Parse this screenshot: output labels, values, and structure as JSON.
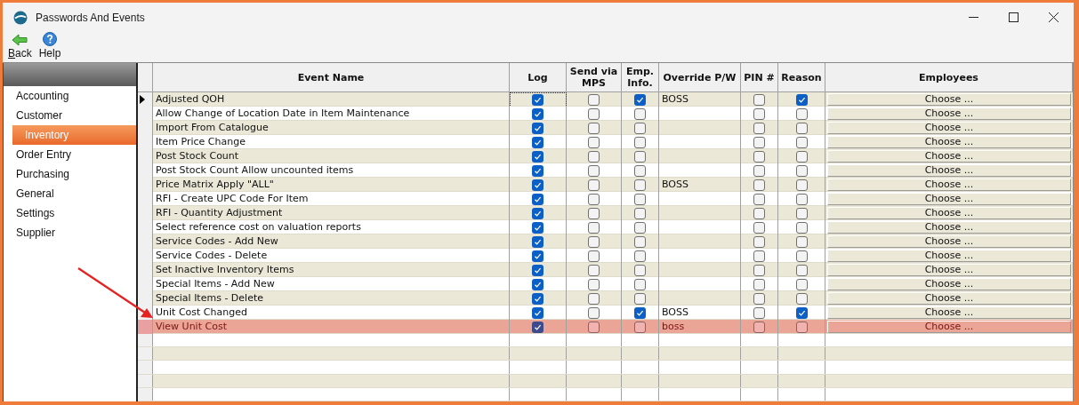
{
  "window": {
    "title": "Passwords And Events"
  },
  "toolbar": [
    {
      "kind": "back",
      "label": "Back"
    },
    {
      "kind": "help",
      "label": "Help"
    }
  ],
  "sidebar": {
    "items": [
      {
        "label": "Accounting",
        "selected": false
      },
      {
        "label": "Customer",
        "selected": false
      },
      {
        "label": "Inventory",
        "selected": true
      },
      {
        "label": "Order Entry",
        "selected": false
      },
      {
        "label": "Purchasing",
        "selected": false
      },
      {
        "label": "General",
        "selected": false
      },
      {
        "label": "Settings",
        "selected": false
      },
      {
        "label": "Supplier",
        "selected": false
      }
    ]
  },
  "table": {
    "columns": [
      "Event Name",
      "Log",
      "Send via MPS",
      "Emp. Info.",
      "Override P/W",
      "PIN #",
      "Reason",
      "Employees"
    ],
    "rows": [
      {
        "event": "Adjusted QOH",
        "log": true,
        "mps": false,
        "emp_info": true,
        "override": "BOSS",
        "pin": false,
        "reason": true,
        "employees": "Choose ...",
        "current": true,
        "highlighted": false
      },
      {
        "event": "Allow Change of Location Date in Item Maintenance",
        "log": true,
        "mps": false,
        "emp_info": false,
        "pin": false,
        "reason": false,
        "employees": "Choose ...",
        "current": false,
        "highlighted": false
      },
      {
        "event": "Import From Catalogue",
        "log": true,
        "mps": false,
        "emp_info": false,
        "pin": false,
        "reason": false,
        "employees": "Choose ...",
        "current": false,
        "highlighted": false
      },
      {
        "event": "Item Price Change",
        "log": true,
        "mps": false,
        "emp_info": false,
        "pin": false,
        "reason": false,
        "employees": "Choose ...",
        "current": false,
        "highlighted": false
      },
      {
        "event": "Post Stock Count",
        "log": true,
        "mps": false,
        "emp_info": false,
        "pin": false,
        "reason": false,
        "employees": "Choose ...",
        "current": false,
        "highlighted": false
      },
      {
        "event": "Post Stock Count Allow uncounted items",
        "log": true,
        "mps": false,
        "emp_info": false,
        "pin": false,
        "reason": false,
        "employees": "Choose ...",
        "current": false,
        "highlighted": false
      },
      {
        "event": "Price Matrix Apply \"ALL\"",
        "log": true,
        "mps": false,
        "emp_info": false,
        "override": "BOSS",
        "pin": false,
        "reason": false,
        "employees": "Choose ...",
        "current": false,
        "highlighted": false
      },
      {
        "event": "RFI - Create UPC Code For Item",
        "log": true,
        "mps": false,
        "emp_info": false,
        "pin": false,
        "reason": false,
        "employees": "Choose ...",
        "current": false,
        "highlighted": false
      },
      {
        "event": "RFI - Quantity Adjustment",
        "log": true,
        "mps": false,
        "emp_info": false,
        "pin": false,
        "reason": false,
        "employees": "Choose ...",
        "current": false,
        "highlighted": false
      },
      {
        "event": "Select reference cost on valuation reports",
        "log": true,
        "mps": false,
        "emp_info": false,
        "pin": false,
        "reason": false,
        "employees": "Choose ...",
        "current": false,
        "highlighted": false
      },
      {
        "event": "Service Codes - Add New",
        "log": true,
        "mps": false,
        "emp_info": false,
        "pin": false,
        "reason": false,
        "employees": "Choose ...",
        "current": false,
        "highlighted": false
      },
      {
        "event": "Service Codes - Delete",
        "log": true,
        "mps": false,
        "emp_info": false,
        "pin": false,
        "reason": false,
        "employees": "Choose ...",
        "current": false,
        "highlighted": false
      },
      {
        "event": "Set Inactive Inventory Items",
        "log": true,
        "mps": false,
        "emp_info": false,
        "pin": false,
        "reason": false,
        "employees": "Choose ...",
        "current": false,
        "highlighted": false
      },
      {
        "event": "Special Items - Add New",
        "log": true,
        "mps": false,
        "emp_info": false,
        "pin": false,
        "reason": false,
        "employees": "Choose ...",
        "current": false,
        "highlighted": false
      },
      {
        "event": "Special Items - Delete",
        "log": true,
        "mps": false,
        "emp_info": false,
        "pin": false,
        "reason": false,
        "employees": "Choose ...",
        "current": false,
        "highlighted": false
      },
      {
        "event": "Unit Cost Changed",
        "log": true,
        "mps": false,
        "emp_info": true,
        "override": "BOSS",
        "pin": false,
        "reason": true,
        "employees": "Choose ...",
        "current": false,
        "highlighted": false
      },
      {
        "event": "View Unit Cost",
        "log": true,
        "mps": false,
        "emp_info": false,
        "override": "boss",
        "pin": false,
        "reason": false,
        "employees": "Choose ...",
        "current": false,
        "highlighted": true
      }
    ]
  },
  "annotation": {
    "kind": "arrow"
  }
}
